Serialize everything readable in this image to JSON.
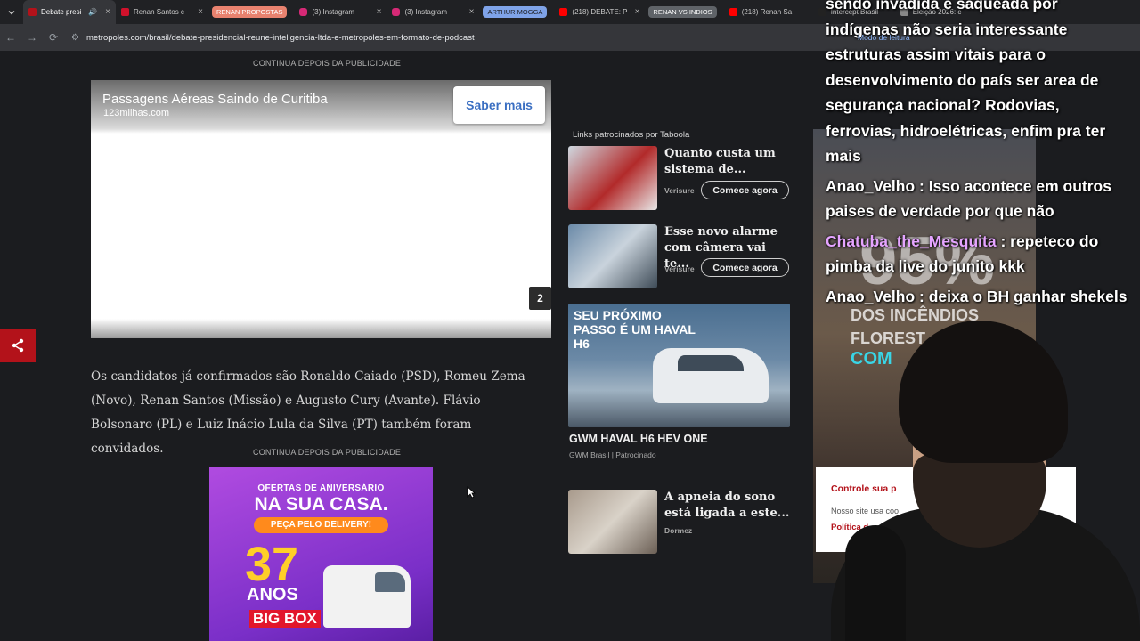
{
  "browser": {
    "tabs": [
      {
        "label": "Debate presi",
        "color": "#b3121a",
        "active": true
      },
      {
        "label": "Renan Santos c",
        "color": "#d0112b"
      },
      {
        "group": "RENAN PROPOSTAS",
        "groupColor": "#e8826f"
      },
      {
        "label": "(3) Instagram",
        "color": "#d62976"
      },
      {
        "label": "(3) Instagram",
        "color": "#d62976"
      },
      {
        "group": "ARTHUR MOGGA",
        "groupColor": "#7fa3e8"
      },
      {
        "label": "(218) DEBATE: P",
        "color": "#ff0000"
      },
      {
        "group": "RENAN VS INDIOS",
        "groupColor": "#5f6368"
      },
      {
        "label": "(218) Renan Sa",
        "color": "#ff0000"
      },
      {
        "label": "Intercept Brasil",
        "color": "#222222"
      },
      {
        "label": "Eleição 2026: c",
        "color": "#888888"
      }
    ],
    "url": "metropoles.com/brasil/debate-presidencial-reune-inteligencia-ltda-e-metropoles-em-formato-de-podcast",
    "reading_mode": "Modo de leitura"
  },
  "page": {
    "pub_label_1": "CONTINUA DEPOIS DA PUBLICIDADE",
    "pub_label_2": "CONTINUA DEPOIS DA PUBLICIDADE",
    "ad": {
      "title": "Passagens Aéreas Saindo de Curitiba",
      "domain": "123milhas.com",
      "button": "Saber mais",
      "count": "2"
    },
    "article_text": "Os candidatos já confirmados são Ronaldo Caiado (PSD), Romeu Zema (Novo), Renan Santos (Missão) e Augusto Cury (Avante). Flávio Bolsonaro (PL) e Luiz Inácio Lula da Silva (PT) também foram convidados.",
    "promo": {
      "line1": "OFERTAS DE ANIVERSÁRIO",
      "line2": "NA SUA CASA.",
      "line3": "PEÇA PELO DELIVERY!",
      "number": "37",
      "line4": "ANOS",
      "brand": "BIG BOX"
    },
    "sponsored": {
      "header": "Links patrocinados por Taboola",
      "items": [
        {
          "title": "Quanto custa um sistema de...",
          "source": "Verisure",
          "button": "Comece agora"
        },
        {
          "title": "Esse novo alarme com câmera vai te...",
          "source": "Verisure",
          "button": "Comece agora"
        },
        {
          "title": "A apneia do sono está ligada a este...",
          "source": "Dormez"
        }
      ],
      "haval": {
        "headline": "SEU PRÓXIMO PASSO É UM HAVAL H6",
        "title": "GWM HAVAL H6 HEV ONE",
        "sub": "GWM Brasil | Patrocinado"
      }
    }
  },
  "overlay": {
    "stream_big": "95%",
    "stream_line1": "DOS INCÊNDIOS",
    "stream_line2": "FLOREST",
    "stream_line3": "COM",
    "consent": {
      "title": "Controle sua p",
      "text": "Nosso site usa coo",
      "link": "Política d"
    },
    "chat": [
      {
        "user": "",
        "text": "sendo invadida e saqueada por indígenas não seria interessante estruturas assim vitais para o desenvolvimento do país ser area de segurança nacional? Rodovias, ferrovias, hidroelétricas, enfim pra ter mais"
      },
      {
        "user": "Anao_Velho",
        "text": ": Isso acontece em outros paises de verdade por que não",
        "pink": false
      },
      {
        "user": "Chatuba_the_Mesquita",
        "text": ": repeteco do pimba da live do junito kkk",
        "pink": true
      },
      {
        "user": "Anao_Velho",
        "text": ": deixa o BH ganhar shekels",
        "pink": false
      }
    ]
  }
}
